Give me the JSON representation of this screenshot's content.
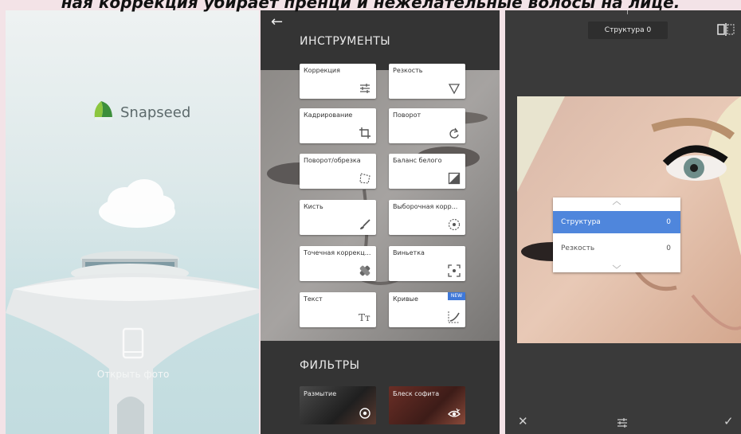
{
  "caption": "ная коррекция убирает пренци и нежелательные волосы на лице.",
  "screen1": {
    "app_name": "Snapseed",
    "open_photo_label": "Открыть фото"
  },
  "screen2": {
    "tools_title": "ИНСТРУМЕНТЫ",
    "tools": [
      {
        "label": "Коррекция",
        "icon": "tune-icon"
      },
      {
        "label": "Резкость",
        "icon": "triangle-icon"
      },
      {
        "label": "Кадрирование",
        "icon": "crop-icon"
      },
      {
        "label": "Поворот",
        "icon": "rotate-icon"
      },
      {
        "label": "Поворот/обрезка",
        "icon": "perspective-icon"
      },
      {
        "label": "Баланс белого",
        "icon": "white-balance-icon"
      },
      {
        "label": "Кисть",
        "icon": "brush-icon"
      },
      {
        "label": "Выборочная корр...",
        "icon": "selective-icon"
      },
      {
        "label": "Точечная коррекц...",
        "icon": "healing-icon"
      },
      {
        "label": "Виньетка",
        "icon": "vignette-icon"
      },
      {
        "label": "Текст",
        "icon": "text-icon"
      },
      {
        "label": "Кривые",
        "icon": "curves-icon",
        "badge": "NEW"
      }
    ],
    "filters_title": "ФИЛЬТРЫ",
    "filters": [
      {
        "label": "Размытие",
        "icon": "lens-blur-icon"
      },
      {
        "label": "Блеск софита",
        "icon": "glamour-glow-icon"
      }
    ]
  },
  "screen3": {
    "title": "Структура 0",
    "adjust_menu": [
      {
        "name": "Структура",
        "value": "0",
        "selected": true
      },
      {
        "name": "Резкость",
        "value": "0",
        "selected": false
      }
    ],
    "bottom_bar": {
      "cancel": "✕",
      "apply": "✓"
    }
  },
  "colors": {
    "accent": "#4f86dc",
    "badge": "#3f78d8",
    "dark_bg": "#343434",
    "sky": "#c9e0e3"
  }
}
